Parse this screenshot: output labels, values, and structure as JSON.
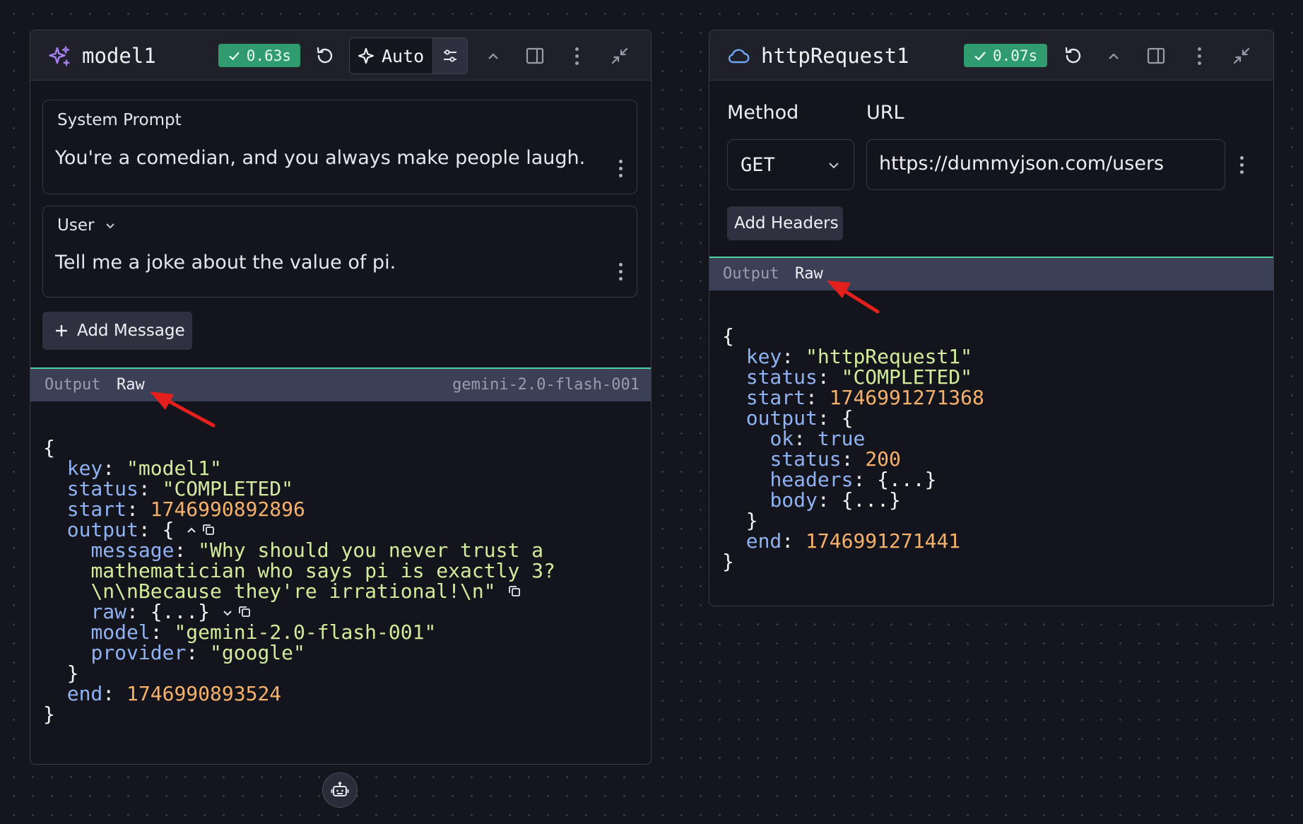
{
  "model_node": {
    "title": "model1",
    "timing": "0.63s",
    "mode_label": "Auto",
    "system_prompt": {
      "label": "System Prompt",
      "text": "You're a comedian, and you always make people laugh."
    },
    "user_message": {
      "role": "User",
      "text": "Tell me a joke about the value of pi."
    },
    "add_message_label": "Add Message",
    "output_tab": "Output",
    "raw_tab": "Raw",
    "model_name": "gemini-2.0-flash-001",
    "json": {
      "open_brace": "{",
      "key_k": "key",
      "key_v": "\"model1\"",
      "status_k": "status",
      "status_v": "\"COMPLETED\"",
      "start_k": "start",
      "start_v": "1746990892896",
      "output_k": "output",
      "message_k": "message",
      "message_l1": "\"Why should you never trust a",
      "message_l2": "mathematician who says pi is exactly 3?",
      "message_l3": "\\n\\nBecause they're irrational!\\n\"",
      "raw_k": "raw",
      "raw_v": "{...}",
      "model_k": "model",
      "model_v": "\"gemini-2.0-flash-001\"",
      "provider_k": "provider",
      "provider_v": "\"google\"",
      "inner_close": "}",
      "end_k": "end",
      "end_v": "1746990893524",
      "close_brace": "}"
    }
  },
  "http_node": {
    "title": "httpRequest1",
    "timing": "0.07s",
    "method_label": "Method",
    "url_label": "URL",
    "method_value": "GET",
    "url_value": "https://dummyjson.com/users",
    "add_headers_label": "Add Headers",
    "output_tab": "Output",
    "raw_tab": "Raw",
    "json": {
      "open_brace": "{",
      "key_k": "key",
      "key_v": "\"httpRequest1\"",
      "status_k": "status",
      "status_v": "\"COMPLETED\"",
      "start_k": "start",
      "start_v": "1746991271368",
      "output_k": "output",
      "ok_k": "ok",
      "ok_v": "true",
      "ostatus_k": "status",
      "ostatus_v": "200",
      "headers_k": "headers",
      "headers_v": "{...}",
      "body_k": "body",
      "body_v": "{...}",
      "inner_close": "}",
      "end_k": "end",
      "end_v": "1746991271441",
      "close_brace": "}"
    }
  },
  "colors": {
    "background": "#15151d",
    "node_bg": "#14141c",
    "badge_green": "#2f9b6f",
    "output_bar": "#3c4056",
    "accent_teal": "#4fd1a6",
    "json_key": "#8fb2f3",
    "json_string": "#d2ec9c",
    "json_number": "#f6b26b",
    "sparkle_purple": "#a982f5",
    "cloud_blue": "#6fa6f2",
    "annotation_red": "#e3201b"
  },
  "icons": {
    "model_node": "sparkle-icon",
    "http_node": "cloud-icon",
    "refresh": "refresh-icon",
    "collapse": "chevron-up-icon",
    "panel": "panel-icon",
    "more": "kebab-icon",
    "minimize": "minimize-icon",
    "bottom": "robot-icon"
  }
}
